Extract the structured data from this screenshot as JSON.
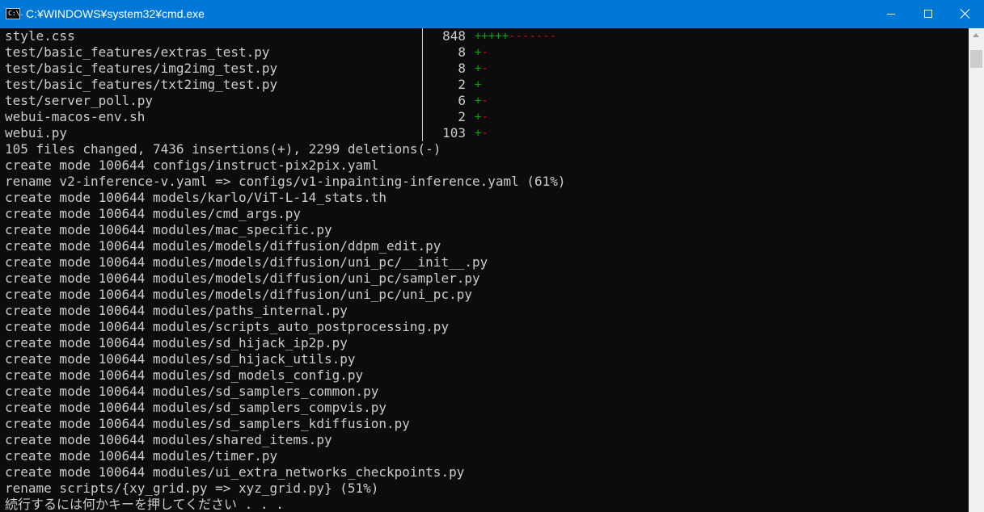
{
  "window": {
    "title": "C:¥WINDOWS¥system32¥cmd.exe",
    "icon_label": "C:\\."
  },
  "stat_lines": [
    {
      "file": "style.css",
      "count": "848",
      "plus": "+++++",
      "minus": "-------"
    },
    {
      "file": "test/basic_features/extras_test.py",
      "count": "8",
      "plus": "+",
      "minus": "-"
    },
    {
      "file": "test/basic_features/img2img_test.py",
      "count": "8",
      "plus": "+",
      "minus": "-"
    },
    {
      "file": "test/basic_features/txt2img_test.py",
      "count": "2",
      "plus": "+",
      "minus": ""
    },
    {
      "file": "test/server_poll.py",
      "count": "6",
      "plus": "+",
      "minus": "-"
    },
    {
      "file": "webui-macos-env.sh",
      "count": "2",
      "plus": "+",
      "minus": "-"
    },
    {
      "file": "webui.py",
      "count": "103",
      "plus": "+",
      "minus": "-"
    }
  ],
  "output_lines": [
    "105 files changed, 7436 insertions(+), 2299 deletions(-)",
    "create mode 100644 configs/instruct-pix2pix.yaml",
    "rename v2-inference-v.yaml => configs/v1-inpainting-inference.yaml (61%)",
    "create mode 100644 models/karlo/ViT-L-14_stats.th",
    "create mode 100644 modules/cmd_args.py",
    "create mode 100644 modules/mac_specific.py",
    "create mode 100644 modules/models/diffusion/ddpm_edit.py",
    "create mode 100644 modules/models/diffusion/uni_pc/__init__.py",
    "create mode 100644 modules/models/diffusion/uni_pc/sampler.py",
    "create mode 100644 modules/models/diffusion/uni_pc/uni_pc.py",
    "create mode 100644 modules/paths_internal.py",
    "create mode 100644 modules/scripts_auto_postprocessing.py",
    "create mode 100644 modules/sd_hijack_ip2p.py",
    "create mode 100644 modules/sd_hijack_utils.py",
    "create mode 100644 modules/sd_models_config.py",
    "create mode 100644 modules/sd_samplers_common.py",
    "create mode 100644 modules/sd_samplers_compvis.py",
    "create mode 100644 modules/sd_samplers_kdiffusion.py",
    "create mode 100644 modules/shared_items.py",
    "create mode 100644 modules/timer.py",
    "create mode 100644 modules/ui_extra_networks_checkpoints.py",
    "rename scripts/{xy_grid.py => xyz_grid.py} (51%)",
    "続行するには何かキーを押してください . . ."
  ],
  "colors": {
    "titlebar": "#0078d7",
    "console_bg": "#0c0c0c",
    "console_fg": "#cccccc",
    "plus": "#13a10e",
    "minus": "#c50f1f"
  }
}
